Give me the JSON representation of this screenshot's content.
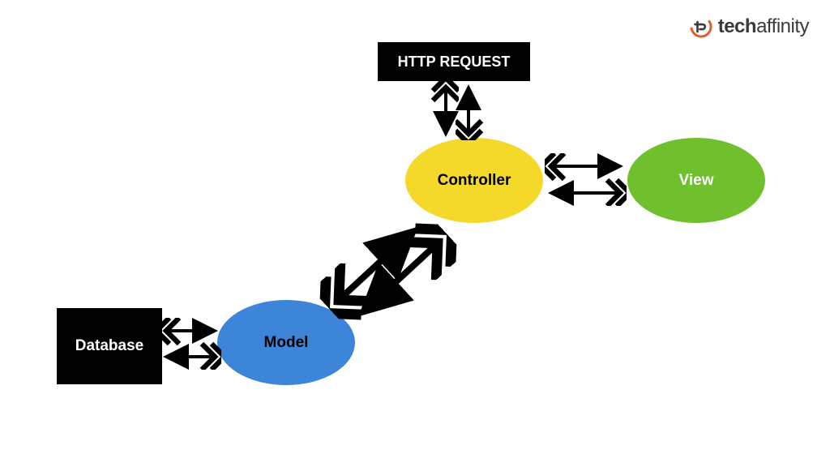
{
  "nodes": {
    "http_request": "HTTP REQUEST",
    "controller": "Controller",
    "view": "View",
    "model": "Model",
    "database": "Database"
  },
  "logo": {
    "brand_bold": "tech",
    "brand_rest": "affinity"
  },
  "connections": [
    {
      "from": "http_request",
      "to": "controller",
      "bidirectional": true
    },
    {
      "from": "controller",
      "to": "view",
      "bidirectional": true
    },
    {
      "from": "controller",
      "to": "model",
      "bidirectional": true
    },
    {
      "from": "database",
      "to": "model",
      "bidirectional": true
    }
  ],
  "colors": {
    "controller": "#f4d82a",
    "view": "#70bf2d",
    "model": "#3d85d8",
    "black": "#000000",
    "logo_accent": "#e95c27"
  }
}
